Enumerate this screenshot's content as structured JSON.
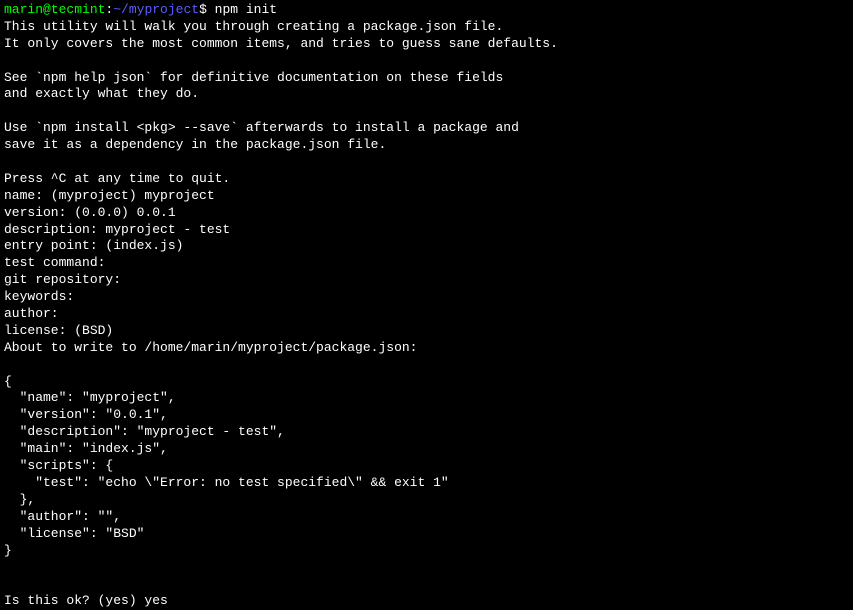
{
  "prompt": {
    "user_host": "marin@tecmint",
    "colon": ":",
    "path": "~/myproject",
    "dollar": "$",
    "command": " npm init"
  },
  "lines": {
    "l1": "This utility will walk you through creating a package.json file.",
    "l2": "It only covers the most common items, and tries to guess sane defaults.",
    "l3": "See `npm help json` for definitive documentation on these fields",
    "l4": "and exactly what they do.",
    "l5": "Use `npm install <pkg> --save` afterwards to install a package and",
    "l6": "save it as a dependency in the package.json file.",
    "l7": "Press ^C at any time to quit.",
    "l8": "name: (myproject) myproject",
    "l9": "version: (0.0.0) 0.0.1",
    "l10": "description: myproject - test",
    "l11": "entry point: (index.js)",
    "l12": "test command:",
    "l13": "git repository:",
    "l14": "keywords:",
    "l15": "author:",
    "l16": "license: (BSD)",
    "l17": "About to write to /home/marin/myproject/package.json:",
    "l18": "{",
    "l19": "  \"name\": \"myproject\",",
    "l20": "  \"version\": \"0.0.1\",",
    "l21": "  \"description\": \"myproject - test\",",
    "l22": "  \"main\": \"index.js\",",
    "l23": "  \"scripts\": {",
    "l24": "    \"test\": \"echo \\\"Error: no test specified\\\" && exit 1\"",
    "l25": "  },",
    "l26": "  \"author\": \"\",",
    "l27": "  \"license\": \"BSD\"",
    "l28": "}",
    "l29": "Is this ok? (yes) yes"
  }
}
